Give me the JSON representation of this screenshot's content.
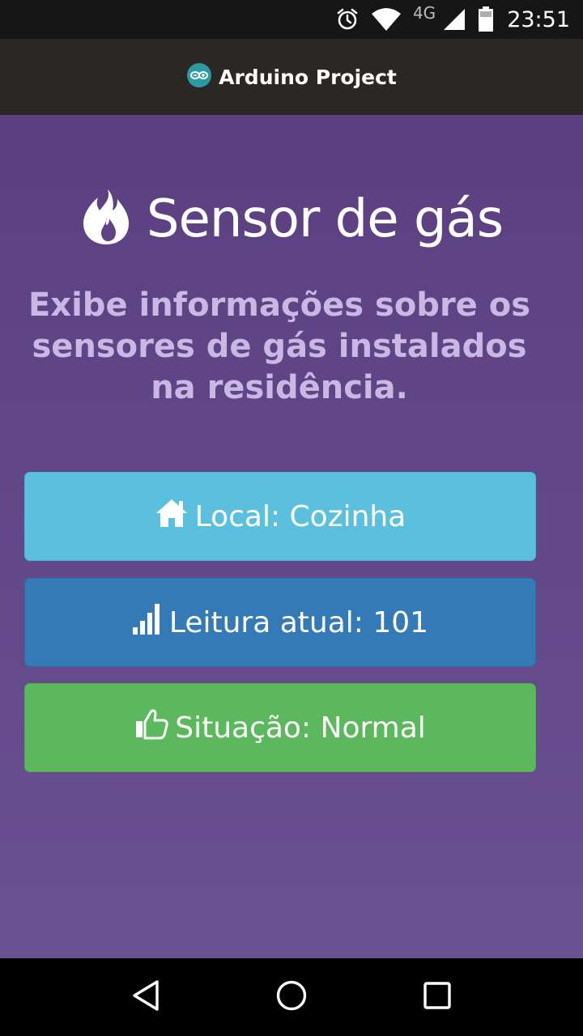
{
  "status_bar": {
    "network_type": "4G",
    "time": "23:51",
    "icons": [
      "alarm-icon",
      "wifi-icon",
      "cell-signal-icon",
      "battery-icon"
    ]
  },
  "app_bar": {
    "title": "Arduino Project",
    "logo_icon": "arduino-logo-icon"
  },
  "hero": {
    "icon": "fire-icon",
    "title": "Sensor de gás",
    "subtitle": "Exibe informações sobre os sensores de gás instalados na residência."
  },
  "panels": {
    "local": {
      "icon": "home-icon",
      "text": "Local: Cozinha",
      "color": "#5bc0de"
    },
    "reading": {
      "icon": "signal-bars-icon",
      "text": "Leitura atual: 101",
      "color": "#337ab7"
    },
    "status": {
      "icon": "thumbs-up-icon",
      "text": "Situação: Normal",
      "color": "#5cb85c"
    }
  },
  "nav_bar": {
    "buttons": [
      "back-icon",
      "home-circle-icon",
      "recents-icon"
    ]
  },
  "colors": {
    "background_top": "#5b3f81",
    "background_bottom": "#6a5192",
    "app_bar": "#2b2724",
    "subtitle": "#c9b8e4"
  }
}
